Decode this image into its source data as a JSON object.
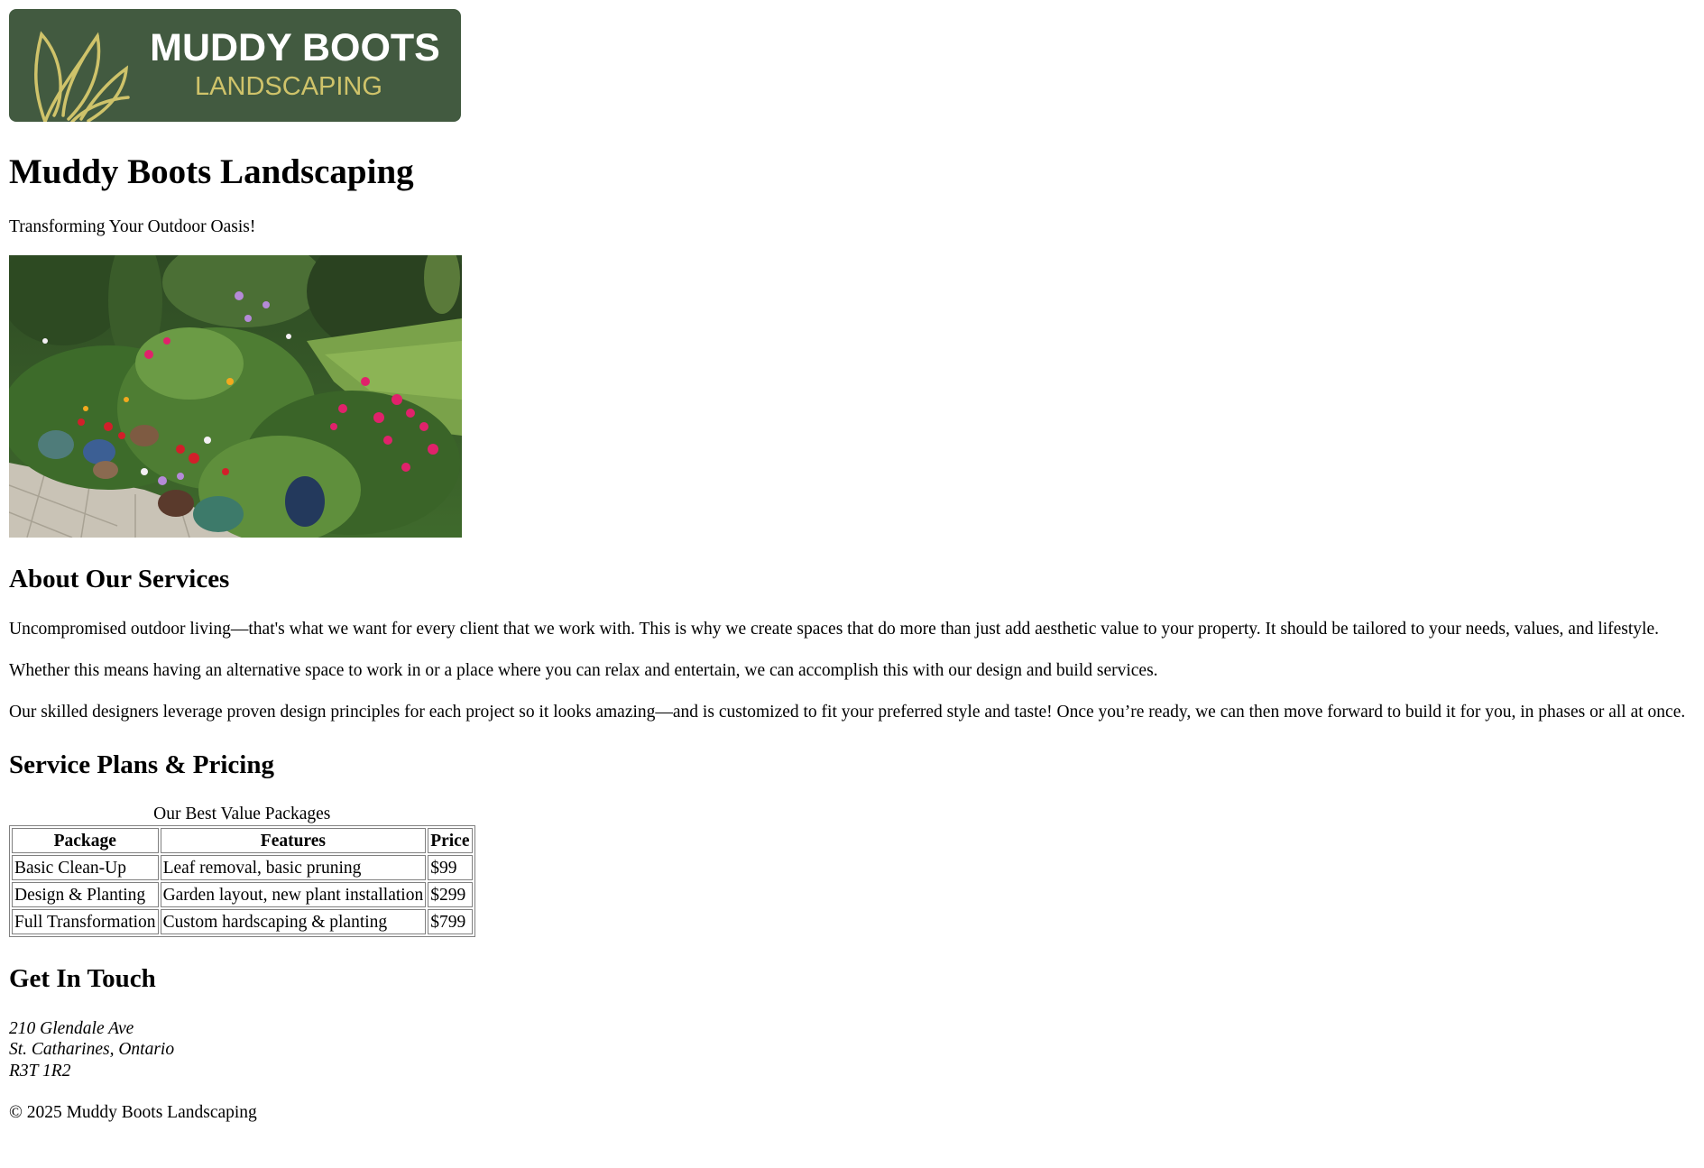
{
  "header": {
    "logo": {
      "line1": "MUDDY BOOTS",
      "line2": "LANDSCAPING",
      "background": "#425a40",
      "text_color": "#ffffff",
      "accent_color": "#cfc36a",
      "icon": "leaf-icon"
    },
    "title": "Muddy Boots Landscaping",
    "tagline": "Transforming Your Outdoor Oasis!"
  },
  "hero": {
    "icon": "garden-photo"
  },
  "about": {
    "heading": "About Our Services",
    "paragraphs": [
      "Uncompromised outdoor living—that's what we want for every client that we work with. This is why we create spaces that do more than just add aesthetic value to your property. It should be tailored to your needs, values, and lifestyle.",
      "Whether this means having an alternative space to work in or a place where you can relax and entertain, we can accomplish this with our design and build services.",
      "Our skilled designers leverage proven design principles for each project so it looks amazing—and is customized to fit your preferred style and taste! Once you’re ready, we can then move forward to build it for you, in phases or all at once."
    ]
  },
  "pricing": {
    "heading": "Service Plans & Pricing",
    "caption": "Our Best Value Packages",
    "columns": [
      "Package",
      "Features",
      "Price"
    ],
    "rows": [
      [
        "Basic Clean-Up",
        "Leaf removal, basic pruning",
        "$99"
      ],
      [
        "Design & Planting",
        "Garden layout, new plant installation",
        "$299"
      ],
      [
        "Full Transformation",
        "Custom hardscaping & planting",
        "$799"
      ]
    ]
  },
  "contact": {
    "heading": "Get In Touch",
    "address_lines": [
      "210 Glendale Ave",
      "St. Catharines, Ontario",
      "R3T 1R2"
    ]
  },
  "footer": {
    "copyright": "© 2025 Muddy Boots Landscaping"
  }
}
